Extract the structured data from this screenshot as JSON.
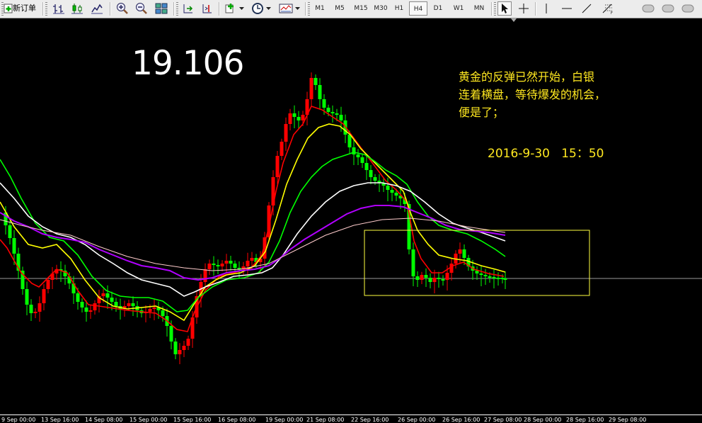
{
  "toolbar": {
    "new_order_label": "新订单",
    "timeframes": [
      "M1",
      "M5",
      "M15",
      "M30",
      "H1",
      "H4",
      "D1",
      "W1",
      "MN"
    ],
    "active_timeframe": "H4"
  },
  "annotations": {
    "price_level": "19.106",
    "comment_lines": [
      "黄金的反弹已然开始，白银",
      "连着横盘，等待爆发的机会，",
      "便是了；"
    ],
    "timestamp": "2016-9-30   15：50"
  },
  "colors": {
    "background": "#000000",
    "bull_candle": "#ff0000",
    "bear_candle": "#00ff00",
    "ma_red": "#ff0000",
    "ma_yellow": "#ffff00",
    "ma_green": "#00ff00",
    "ma_white": "#ffffff",
    "ma_purple": "#b000ff",
    "ma_pink": "#ffcccc",
    "annotation_text": "#ffe820"
  },
  "xaxis_labels": [
    "9 Sep 00:00",
    "13 Sep 16:00",
    "14 Sep 08:00",
    "15 Sep 00:00",
    "15 Sep 16:00",
    "16 Sep 08:00",
    "19 Sep 00:00",
    "21 Sep 08:00",
    "22 Sep 16:00",
    "26 Sep 00:00",
    "26 Sep 16:00",
    "27 Sep 08:00",
    "28 Sep 00:00",
    "28 Sep 16:00",
    "29 Sep 08:00"
  ]
}
